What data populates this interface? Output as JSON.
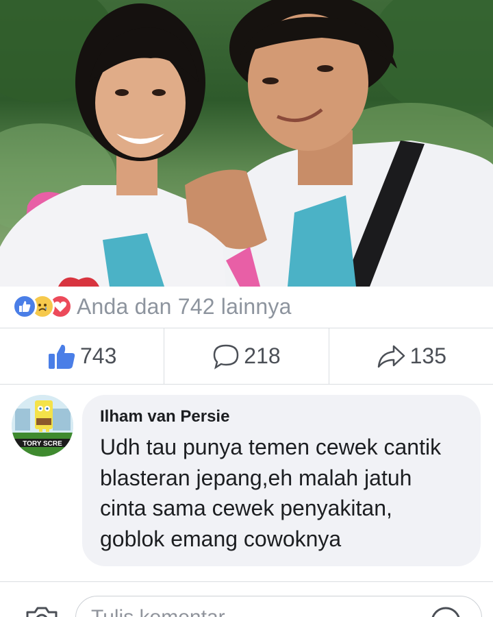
{
  "post": {
    "photo_icon": "photo-two-students-in-school-uniforms"
  },
  "reactions": {
    "icons": [
      "like-reaction-icon",
      "sad-reaction-icon",
      "love-reaction-icon"
    ],
    "summary": "Anda dan 742 lainnya",
    "colors": {
      "like": "#4a7ee7",
      "sad": "#f6c94c",
      "love": "#ec4a5a"
    }
  },
  "actions": {
    "likes": "743",
    "comments": "218",
    "shares": "135"
  },
  "comment": {
    "author": "Ilham van Persie",
    "lines": [
      "Udh tau punya temen cewek cantik",
      "blasteran jepang,eh malah jatuh",
      "cinta sama cewek penyakitan,",
      "goblok emang cowoknya"
    ],
    "avatar_label": "TORY SCRE"
  },
  "composer": {
    "placeholder": "Tulis komentar..."
  },
  "colors": {
    "accent": "#4a7ee7",
    "bubble": "#f1f2f6",
    "muted_text": "#8d949e",
    "divider": "#dadde1"
  }
}
